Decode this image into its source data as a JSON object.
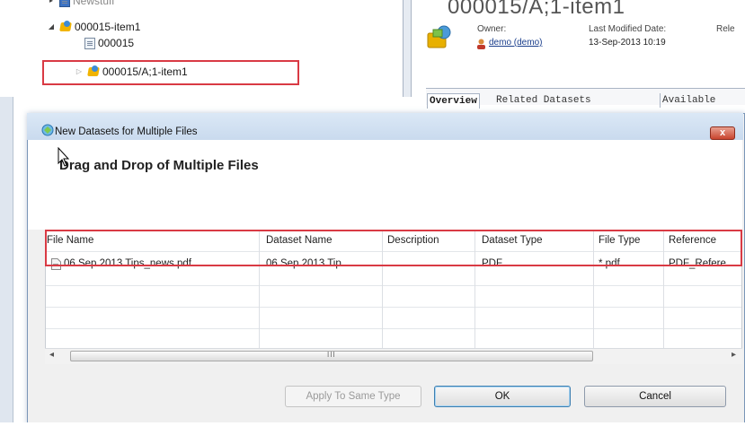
{
  "tree": {
    "items": [
      {
        "label": "Newstuff"
      },
      {
        "label": "000015-item1"
      },
      {
        "label": "000015"
      },
      {
        "label": "000015/A;1-item1"
      }
    ]
  },
  "item_header": {
    "title": "000015/A;1-item1",
    "owner_label": "Owner:",
    "owner_value": "demo (demo)",
    "modified_label": "Last Modified Date:",
    "modified_value": "13-Sep-2013 10:19",
    "release_label": "Rele",
    "tabs": [
      {
        "label": "Overview"
      },
      {
        "label": "Related Datasets"
      },
      {
        "label": "Available"
      }
    ]
  },
  "dialog": {
    "title": "New Datasets for Multiple Files",
    "heading": "Drag and Drop of Multiple Files",
    "close_label": "x",
    "columns": [
      "File Name",
      "Dataset Name",
      "Description",
      "Dataset Type",
      "File Type",
      "Reference"
    ],
    "rows": [
      {
        "file_name": "06 Sep 2013 Tips_news.pdf",
        "dataset_name": "06 Sep 2013 Tip...",
        "description": "",
        "dataset_type": "PDF",
        "file_type": "*.pdf",
        "reference": "PDF_Refere"
      }
    ],
    "scroll_left": "◂",
    "scroll_right": "▸",
    "scroll_grip": "III",
    "buttons": {
      "apply": "Apply To Same Type",
      "ok": "OK",
      "cancel": "Cancel"
    }
  },
  "colors": {
    "highlight_red": "#d93a44",
    "link_blue": "#1a3e8c"
  }
}
